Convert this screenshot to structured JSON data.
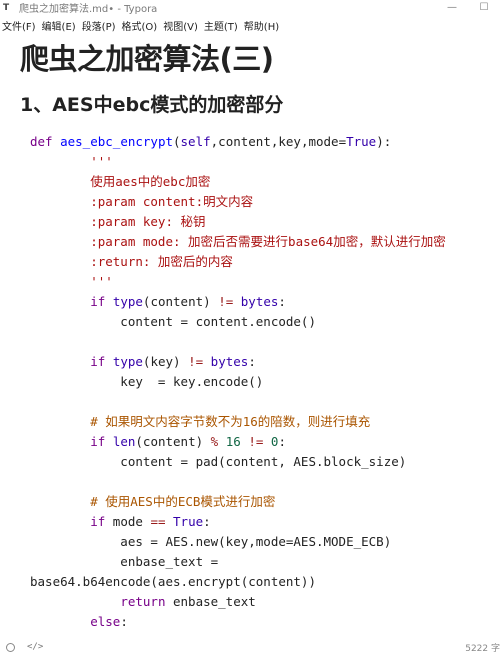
{
  "window": {
    "title": "爬虫之加密算法.md• - Typora",
    "app_icon": "T"
  },
  "menu": [
    "文件(F)",
    "编辑(E)",
    "段落(P)",
    "格式(O)",
    "视图(V)",
    "主题(T)",
    "帮助(H)"
  ],
  "doc": {
    "h1": "爬虫之加密算法(三)",
    "h2": "1、AES中ebc模式的加密部分",
    "code_lines": [
      "def aes_ebc_encrypt(self,content,key,mode=True):",
      "        '''",
      "        使用aes中的ebc加密",
      "        :param content:明文内容",
      "        :param key: 秘钥",
      "        :param mode: 加密后否需要进行base64加密，默认进行加密",
      "        :return: 加密后的内容",
      "        '''",
      "        if type(content) != bytes:",
      "            content = content.encode()",
      "",
      "        if type(key) != bytes:",
      "            key  = key.encode()",
      "",
      "        # 如果明文内容字节数不为16的陪数，则进行填充",
      "        if len(content) % 16 != 0:",
      "            content = pad(content, AES.block_size)",
      "",
      "        # 使用AES中的ECB模式进行加密",
      "        if mode == True:",
      "            aes = AES.new(key,mode=AES.MODE_ECB)",
      "            enbase_text =",
      "base64.b64encode(aes.encrypt(content))",
      "            return enbase_text",
      "        else:"
    ]
  },
  "status": {
    "source_toggle": "</>",
    "word_count": "5222 字"
  }
}
